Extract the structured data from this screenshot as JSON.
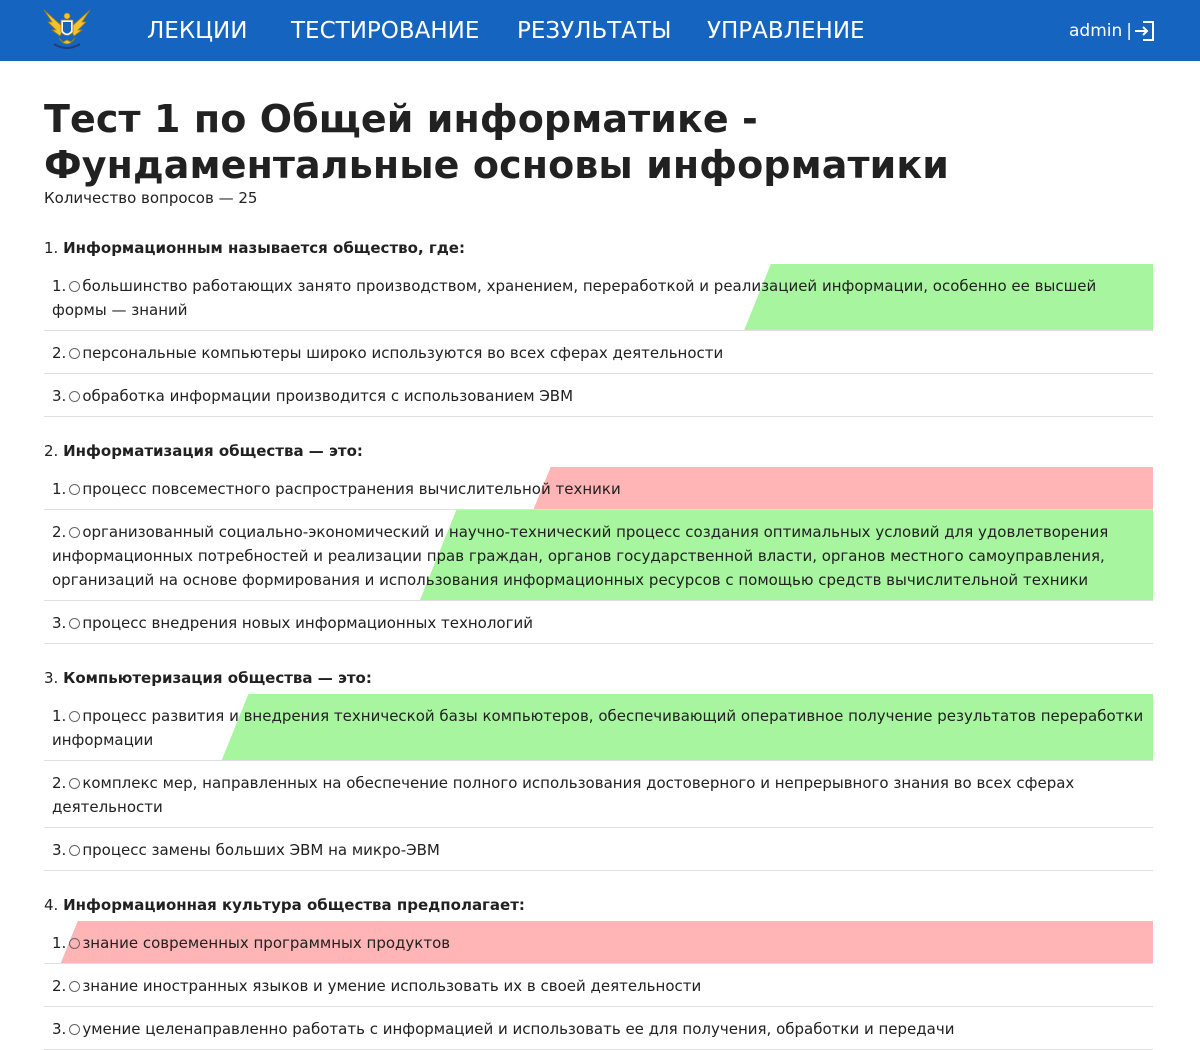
{
  "nav": {
    "items": [
      "ЛЕКЦИИ",
      "ТЕСТИРОВАНИЕ",
      "РЕЗУЛЬТАТЫ",
      "УПРАВЛЕНИЕ"
    ],
    "user": "admin",
    "separator": "|"
  },
  "page": {
    "title": "Тест 1 по Общей информатике - Фундаментальные основы информатики",
    "count": "Количество вопросов — 25"
  },
  "questions": [
    {
      "num": "1.",
      "text": "Информационным называется общество, где:",
      "answers": [
        {
          "num": "1.",
          "text": "большинство работающих занято производством, хранением, переработкой и реализацией информации, особенно ее высшей формы — знаний",
          "status": "correct"
        },
        {
          "num": "2.",
          "text": "персональные компьютеры широко используются во всех сферах деятельности",
          "status": "none"
        },
        {
          "num": "3.",
          "text": "обработка информации производится с использованием ЭВМ",
          "status": "none"
        }
      ]
    },
    {
      "num": "2.",
      "text": "Информатизация общества — это:",
      "answers": [
        {
          "num": "1.",
          "text": "процесс повсеместного распространения вычислительной техники",
          "status": "wrong"
        },
        {
          "num": "2.",
          "text": "организованный социально-экономический и научно-технический процесс создания оптимальных условий для удовлетворения информационных потребностей и реализации прав граждан, органов государственной власти, органов местного самоуправления, организаций на основе формирования и использования информационных ресурсов с помощью средств вычислительной техники",
          "status": "correct"
        },
        {
          "num": "3.",
          "text": "процесс внедрения новых информационных технологий",
          "status": "none"
        }
      ]
    },
    {
      "num": "3.",
      "text": "Компьютеризация общества — это:",
      "answers": [
        {
          "num": "1.",
          "text": "процесс развития и внедрения технической базы компьютеров, обеспечивающий оперативное получение результатов переработки информации",
          "status": "correct"
        },
        {
          "num": "2.",
          "text": "комплекс мер, направленных на обеспечение полного использования достоверного и непрерывного знания во всех сферах деятельности",
          "status": "none"
        },
        {
          "num": "3.",
          "text": "процесс замены больших ЭВМ на микро-ЭВМ",
          "status": "none"
        }
      ]
    },
    {
      "num": "4.",
      "text": "Информационная культура общества предполагает:",
      "answers": [
        {
          "num": "1.",
          "text": "знание современных программных продуктов",
          "status": "wrong"
        },
        {
          "num": "2.",
          "text": "знание иностранных языков и умение использовать их в своей деятельности",
          "status": "none"
        },
        {
          "num": "3.",
          "text": "умение целенаправленно работать с информацией и использовать ее для получения, обработки и передачи",
          "status": "none"
        }
      ]
    }
  ],
  "colors": {
    "navbar": "#1565c0",
    "correct": "#a8f5a0",
    "wrong": "#ffb5b5"
  }
}
